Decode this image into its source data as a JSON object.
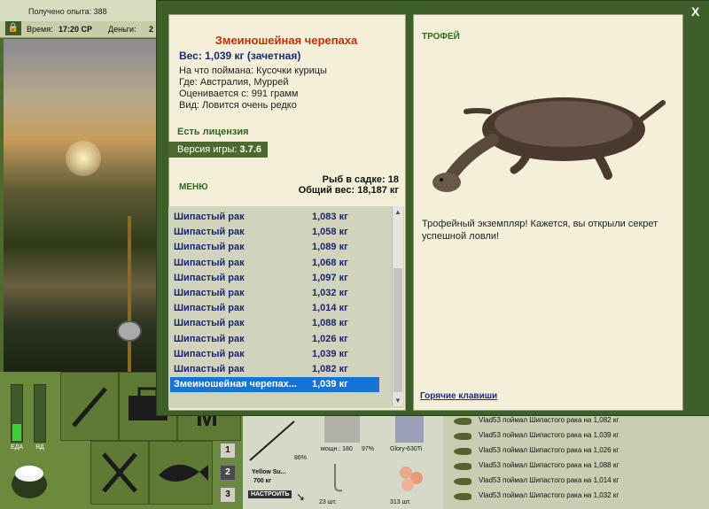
{
  "status": {
    "experience": "Получено опыта: 388",
    "time_label": "Время:",
    "time_value": "17:20 СР",
    "money_label": "Деньги:",
    "money_value": "2"
  },
  "dialog": {
    "close": "X",
    "fish_name": "Змеиношейная черепаха",
    "weight": "Вес: 1,039 кг (зачетная)",
    "details": [
      "На что поймана: Кусочки курицы",
      "Где: Австралия, Муррей",
      "Оценивается с: 991 грамм",
      "Вид: Ловится очень редко"
    ],
    "license": "Есть лицензия",
    "version_label": "Версия игры:",
    "version_value": "3.7.6",
    "menu": "МЕНЮ",
    "keepnet_count": "Рыб в садке: 18",
    "total_weight": "Общий вес: 18,187 кг",
    "catch_list": [
      {
        "name": "Шипастый рак",
        "weight": "1,083 кг"
      },
      {
        "name": "Шипастый рак",
        "weight": "1,058 кг"
      },
      {
        "name": "Шипастый рак",
        "weight": "1,089 кг"
      },
      {
        "name": "Шипастый рак",
        "weight": "1,068 кг"
      },
      {
        "name": "Шипастый рак",
        "weight": "1,097 кг"
      },
      {
        "name": "Шипастый рак",
        "weight": "1,032 кг"
      },
      {
        "name": "Шипастый рак",
        "weight": "1,014 кг"
      },
      {
        "name": "Шипастый рак",
        "weight": "1,088 кг"
      },
      {
        "name": "Шипастый рак",
        "weight": "1,026 кг"
      },
      {
        "name": "Шипастый рак",
        "weight": "1,039 кг"
      },
      {
        "name": "Шипастый рак",
        "weight": "1,082 кг"
      },
      {
        "name": "Змеиношейная черепах...",
        "weight": "1,039 кг"
      }
    ],
    "selected_index": 11,
    "trophy_label": "ТРОФЕЙ",
    "trophy_text": "Трофейный экземпляр! Кажется, вы открыли секрет успешной ловли!",
    "hotkeys": "Горячие клавиши"
  },
  "meters": {
    "left_label": "ЕДА",
    "right_label": "ЯД",
    "food_level": 0.3,
    "poison_level": 0.0
  },
  "pages": [
    "1",
    "2",
    "3"
  ],
  "inventory": {
    "rod_name": "Yellow Su...",
    "rod_weight": "700 кг",
    "rod_percent": "86%",
    "tune_button": "НАСТРОИТЬ",
    "reel_info": "мощн.: 180",
    "reel_percent": "97%",
    "line_name": "Glory-630Ti",
    "hook_count": "23 шт.",
    "bait_count": "313 шт."
  },
  "log": [
    "Vlad53 поймал Шипастого рака на 1,082 кг",
    "Vlad53 поймал Шипастого рака на 1,039 кг",
    "Vlad53 поймал Шипастого рака на 1,026 кг",
    "Vlad53 поймал Шипастого рака на 1,088 кг",
    "Vlad53 поймал Шипастого рака на 1,014 кг",
    "Vlad53 поймал Шипастого рака на 1,032 кг"
  ]
}
